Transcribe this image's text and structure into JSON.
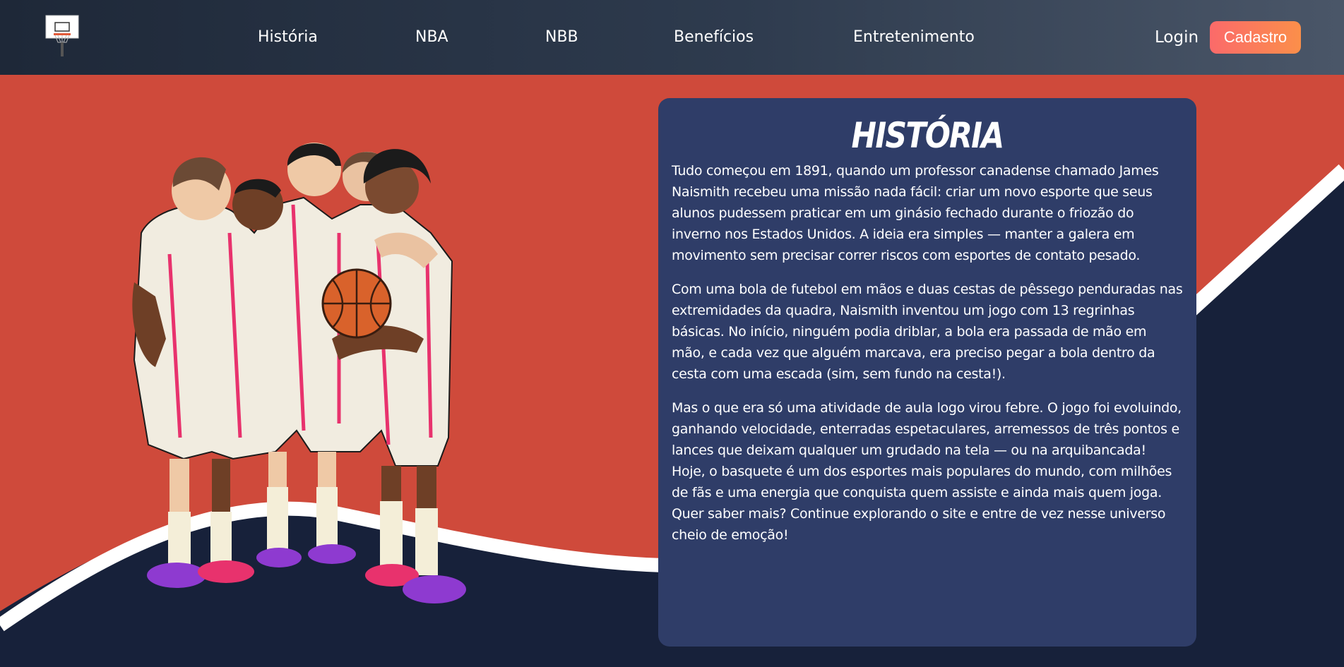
{
  "header": {
    "logo_icon": "basketball-hoop-icon",
    "nav": [
      {
        "label": "História"
      },
      {
        "label": "NBA"
      },
      {
        "label": "NBB"
      },
      {
        "label": "Benefícios"
      },
      {
        "label": "Entretenimento"
      }
    ],
    "login_label": "Login",
    "signup_label": "Cadastro"
  },
  "hero": {
    "illustration": "basketball-team-huddle-illustration",
    "background_color": "#cf4a3b",
    "court_color": "#17213a",
    "line_color": "#ffffff"
  },
  "history": {
    "title": "HISTÓRIA",
    "paragraphs": [
      "Tudo começou em 1891, quando um professor canadense chamado James Naismith recebeu uma missão nada fácil: criar um novo esporte que seus alunos pudessem praticar em um ginásio fechado durante o friozão do inverno nos Estados Unidos. A ideia era simples — manter a galera em movimento sem precisar correr riscos com esportes de contato pesado.",
      "Com uma bola de futebol em mãos e duas cestas de pêssego penduradas nas extremidades da quadra, Naismith inventou um jogo com 13 regrinhas básicas. No início, ninguém podia driblar, a bola era passada de mão em mão, e cada vez que alguém marcava, era preciso pegar a bola dentro da cesta com uma escada (sim, sem fundo na cesta!).",
      "Mas o que era só uma atividade de aula logo virou febre. O jogo foi evoluindo, ganhando velocidade, enterradas espetaculares, arremessos de três pontos e lances que deixam qualquer um grudado na tela — ou na arquibancada! Hoje, o basquete é um dos esportes mais populares do mundo, com milhões de fãs e uma energia que conquista quem assiste e ainda mais quem joga. Quer saber mais? Continue explorando o site e entre de vez nesse universo cheio de emoção!"
    ],
    "card_color": "#2f3d68"
  },
  "colors": {
    "header_start": "#1e2838",
    "header_end": "#4a5668",
    "signup_start": "#fb6a6a",
    "signup_end": "#fb8f4a"
  }
}
